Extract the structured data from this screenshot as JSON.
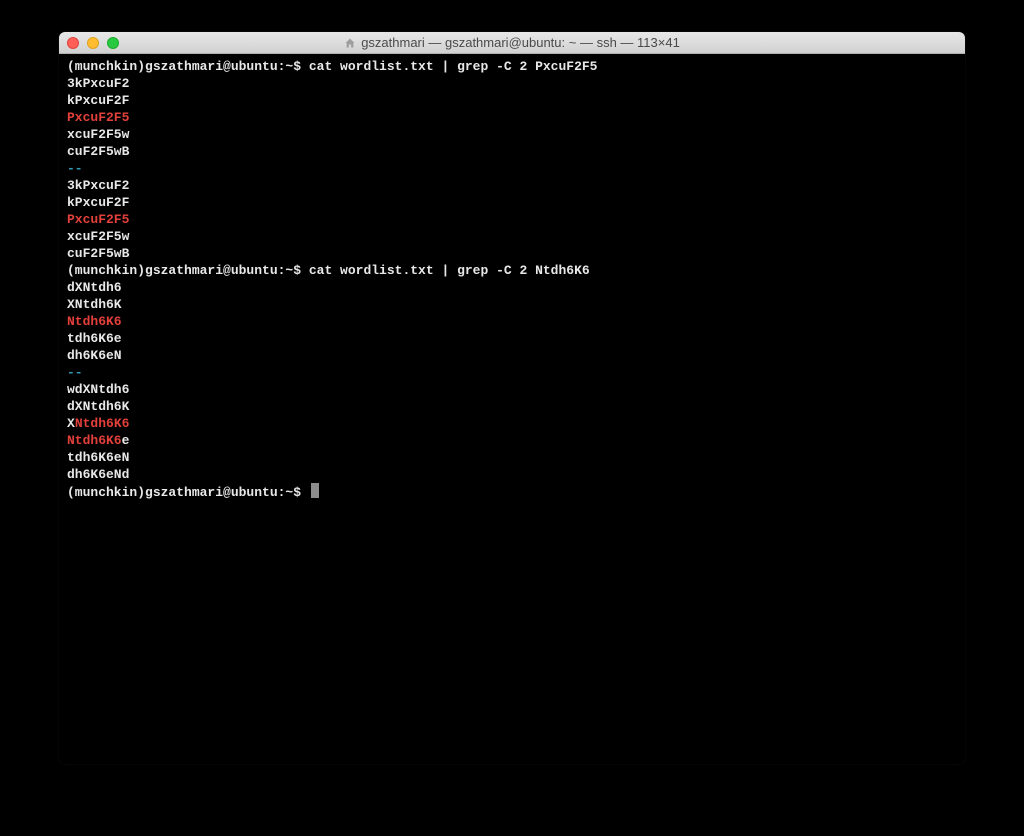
{
  "title": "gszathmari — gszathmari@ubuntu: ~ — ssh — 113×41",
  "prompt": "(munchkin)gszathmari@ubuntu:~$ ",
  "lines": [
    {
      "type": "prompt-cmd",
      "cmd": "cat wordlist.txt | grep -C 2 PxcuF2F5"
    },
    {
      "type": "plain",
      "text": "3kPxcuF2"
    },
    {
      "type": "plain",
      "text": "kPxcuF2F"
    },
    {
      "type": "match-full",
      "text": "PxcuF2F5"
    },
    {
      "type": "plain",
      "text": "xcuF2F5w"
    },
    {
      "type": "plain",
      "text": "cuF2F5wB"
    },
    {
      "type": "sep",
      "text": "--"
    },
    {
      "type": "plain",
      "text": "3kPxcuF2"
    },
    {
      "type": "plain",
      "text": "kPxcuF2F"
    },
    {
      "type": "match-full",
      "text": "PxcuF2F5"
    },
    {
      "type": "plain",
      "text": "xcuF2F5w"
    },
    {
      "type": "plain",
      "text": "cuF2F5wB"
    },
    {
      "type": "prompt-cmd",
      "cmd": "cat wordlist.txt | grep -C 2 Ntdh6K6"
    },
    {
      "type": "plain",
      "text": "dXNtdh6"
    },
    {
      "type": "plain",
      "text": "XNtdh6K"
    },
    {
      "type": "match-full",
      "text": "Ntdh6K6"
    },
    {
      "type": "plain",
      "text": "tdh6K6e"
    },
    {
      "type": "plain",
      "text": "dh6K6eN"
    },
    {
      "type": "sep",
      "text": "--"
    },
    {
      "type": "plain",
      "text": "wdXNtdh6"
    },
    {
      "type": "plain",
      "text": "dXNtdh6K"
    },
    {
      "type": "match-mid",
      "pre": "X",
      "match": "Ntdh6K6",
      "post": ""
    },
    {
      "type": "match-mid",
      "pre": "",
      "match": "Ntdh6K6",
      "post": "e"
    },
    {
      "type": "plain",
      "text": "tdh6K6eN"
    },
    {
      "type": "plain",
      "text": "dh6K6eNd"
    },
    {
      "type": "prompt-cursor"
    }
  ]
}
